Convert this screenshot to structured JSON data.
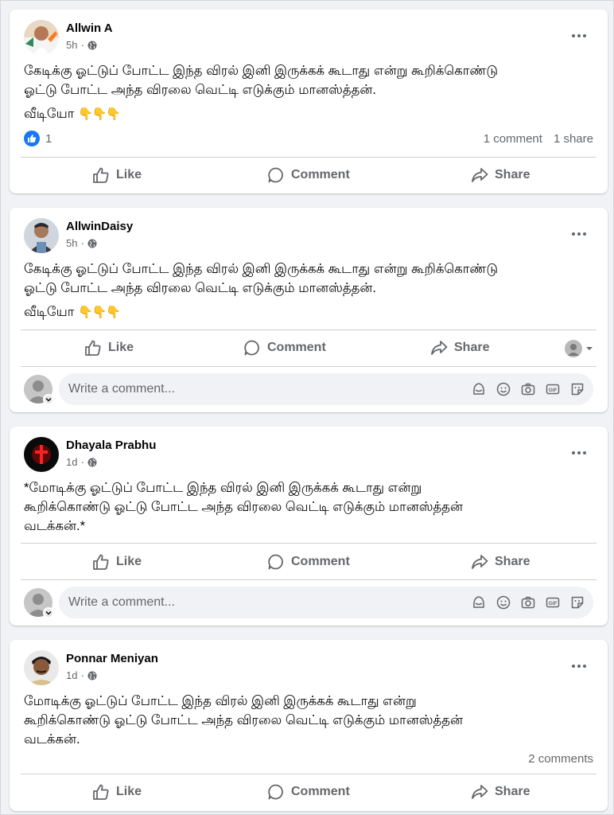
{
  "posts": [
    {
      "author": "Allwin A",
      "time": "5h",
      "text_line1": "கேடிக்கு ஓட்டுப் போட்ட இந்த விரல் இனி இருக்கக் கூடாது என்று கூறிக்கொண்டு",
      "text_line2": "ஓட்டு போட்ட அந்த விரலை வெட்டி எடுக்கும் மானஸ்த்தன்.",
      "text_line3": "வீடியோ",
      "emoji": "👇👇👇",
      "likes": "1",
      "comments": "1 comment",
      "shares": "1 share"
    },
    {
      "author": "AllwinDaisy",
      "time": "5h",
      "text_line1": "கேடிக்கு ஓட்டுப் போட்ட இந்த விரல் இனி இருக்கக் கூடாது என்று கூறிக்கொண்டு",
      "text_line2": "ஓட்டு போட்ட அந்த விரலை வெட்டி எடுக்கும் மானஸ்த்தன்.",
      "text_line3": "வீடியோ",
      "emoji": "👇👇👇"
    },
    {
      "author": "Dhayala Prabhu",
      "time": "1d",
      "text_line1": "*மோடிக்கு ஓட்டுப் போட்ட இந்த விரல் இனி இருக்கக் கூடாது என்று",
      "text_line2": "கூறிக்கொண்டு ஓட்டு போட்ட அந்த விரலை வெட்டி எடுக்கும் மானஸ்த்தன்",
      "text_line3": "வடக்கன்.*"
    },
    {
      "author": "Ponnar Meniyan",
      "time": "1d",
      "text_line1": "மோடிக்கு ஓட்டுப் போட்ட இந்த விரல் இனி இருக்கக் கூடாது என்று",
      "text_line2": "கூறிக்கொண்டு ஓட்டு போட்ட அந்த விரலை வெட்டி எடுக்கும் மானஸ்த்தன்",
      "text_line3": "வடக்கன்.",
      "comments": "2 comments"
    }
  ],
  "actions": {
    "like": "Like",
    "comment": "Comment",
    "share": "Share"
  },
  "comment_placeholder": "Write a comment...",
  "icons": {
    "privacy": "globe-icon",
    "more": "more-options-icon",
    "like": "thumbs-up-icon",
    "comment": "speech-bubble-icon",
    "share": "share-arrow-icon",
    "comment_tools": [
      "avatar-sticker-icon",
      "emoji-icon",
      "camera-icon",
      "gif-icon",
      "sticker-icon"
    ]
  },
  "colors": {
    "accent": "#1877f2",
    "secondary_text": "#65676b",
    "background": "#f0f2f5"
  }
}
